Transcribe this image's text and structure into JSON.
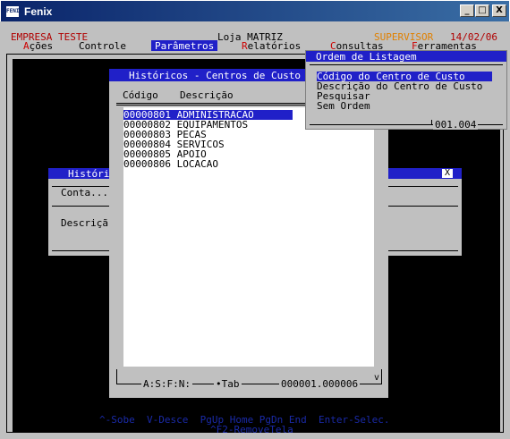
{
  "window": {
    "title": "Fenix",
    "icon_text": "FENIX",
    "minimize": "_",
    "maximize": "□",
    "close": "X"
  },
  "header": {
    "company": "EMPRESA TESTE",
    "store": "Loja MATRIZ",
    "user": "SUPERVISOR",
    "date": "14/02/06"
  },
  "menu": [
    {
      "hotkey": "A",
      "rest": "ções"
    },
    {
      "hotkey": "",
      "rest": "Controle"
    },
    {
      "hotkey": "",
      "rest": "Parâmetros"
    },
    {
      "hotkey": "R",
      "rest": "elatórios"
    },
    {
      "hotkey": "C",
      "rest": "onsultas"
    },
    {
      "hotkey": "F",
      "rest": "erramentas"
    }
  ],
  "back_dialog": {
    "title": "Históri",
    "close": "X",
    "conta_label": "Conta...",
    "descricao_label": "Descriçã"
  },
  "list_dialog": {
    "title": "Históricos - Centros de Custo",
    "col_code": "Código",
    "col_desc": "Descrição",
    "rows": [
      {
        "code": "00000801",
        "desc": "ADMINISTRACAO"
      },
      {
        "code": "00000802",
        "desc": "EQUIPAMENTOS"
      },
      {
        "code": "00000803",
        "desc": "PECAS"
      },
      {
        "code": "00000804",
        "desc": "SERVICOS"
      },
      {
        "code": "00000805",
        "desc": "APOIO"
      },
      {
        "code": "00000806",
        "desc": "LOCACAO"
      }
    ],
    "scroll_down": "v",
    "footer_keys": "A:S:F:N:",
    "footer_tab": "Tab",
    "footer_count": "000001.000006"
  },
  "order_menu": {
    "title": "Ordem de Listagem",
    "items": [
      "Código do Centro de Custo",
      "Descrição do Centro de Custo",
      "Pesquisar",
      "Sem Ordem"
    ],
    "counter": "001.004"
  },
  "help": {
    "line1": "^-Sobe  V-Desce  PgUp Home PgDn End  Enter-Selec.",
    "line2": "^F2-RemoveTela"
  },
  "colors": {
    "highlight": "#2020c8",
    "hotkey": "#cc0000",
    "supervisor": "#e08000",
    "company": "#b00000",
    "help": "#1a2aa8"
  }
}
